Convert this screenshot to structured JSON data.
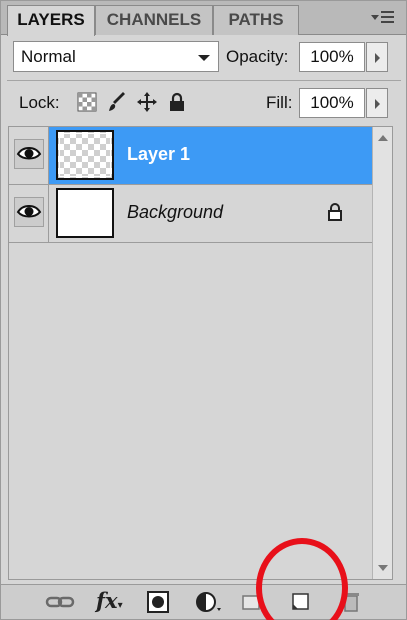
{
  "tabs": [
    {
      "label": "LAYERS"
    },
    {
      "label": "CHANNELS"
    },
    {
      "label": "PATHS"
    }
  ],
  "panel_menu_icon": "panel-menu-icon",
  "blend_mode": {
    "value": "Normal"
  },
  "opacity": {
    "label": "Opacity:",
    "value": "100%"
  },
  "lock": {
    "label": "Lock:",
    "icons": [
      "lock-transparent-icon",
      "lock-image-icon",
      "lock-position-icon",
      "lock-all-icon"
    ]
  },
  "fill": {
    "label": "Fill:",
    "value": "100%"
  },
  "layers": [
    {
      "name": "Layer 1",
      "selected": true,
      "visible": true,
      "thumbnail": "transparent"
    },
    {
      "name": "Background",
      "selected": false,
      "visible": true,
      "thumbnail": "white",
      "locked": true
    }
  ],
  "toolbar_icons": [
    "link-layers-icon",
    "fx-icon",
    "add-mask-icon",
    "adjustment-layer-icon",
    "new-group-icon",
    "new-layer-icon",
    "delete-layer-icon"
  ],
  "toolbar_text": {
    "fx": "fx"
  },
  "colors": {
    "selection": "#3d9af5",
    "annotation": "#e8101a",
    "panel_bg": "#d6d6d6"
  }
}
